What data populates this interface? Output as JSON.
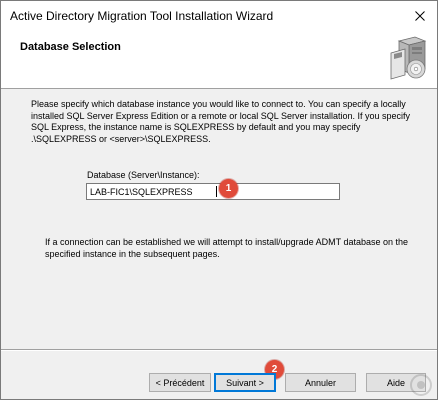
{
  "window": {
    "title": "Active Directory Migration Tool Installation Wizard",
    "close_icon": "close-icon"
  },
  "header": {
    "title": "Database Selection",
    "icon": "installer-box-cd-icon"
  },
  "body": {
    "intro_text": "Please specify which database instance you would like to connect to. You can specify a locally installed SQL Server Express Edition or a remote or local SQL Server installation. If you specify SQL Express, the instance name is SQLEXPRESS by default and you may specify .\\SQLEXPRESS or <server>\\SQLEXPRESS.",
    "database_label": "Database (Server\\Instance):",
    "database_value": "LAB-FIC1\\SQLEXPRESS",
    "connection_note": "If a connection can be established we will attempt to install/upgrade ADMT database on the specified instance in the subsequent pages."
  },
  "markers": {
    "step1": "1",
    "step2": "2",
    "color": "#e04b3a"
  },
  "buttons": {
    "previous": "< Précédent",
    "next": "Suivant >",
    "cancel": "Annuler",
    "help": "Aide"
  },
  "colors": {
    "body_background": "#f0f0f0",
    "focus_border": "#0078d7"
  }
}
